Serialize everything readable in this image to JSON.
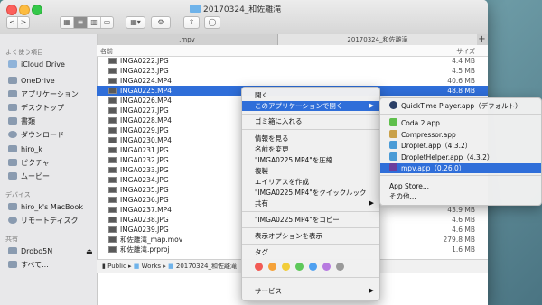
{
  "window": {
    "title": "20170324_和佐離滝",
    "tabs": [
      ".mpv",
      "20170324_和佐離滝"
    ],
    "add_tab": "+",
    "toolbar": {
      "back": "<",
      "forward": ">",
      "action": "⚙"
    }
  },
  "sidebar": {
    "favorites_header": "よく使う項目",
    "favorites": [
      "iCloud Drive",
      "OneDrive",
      "アプリケーション",
      "デスクトップ",
      "書類",
      "ダウンロード",
      "hiro_k",
      "ピクチャ",
      "ムービー"
    ],
    "devices_header": "デバイス",
    "devices": [
      "hiro_k's MacBook",
      "リモートディスク"
    ],
    "shared_header": "共有",
    "shared": [
      "Drobo5N",
      "すべて..."
    ]
  },
  "columns": {
    "name": "名前",
    "size": "サイズ"
  },
  "files": [
    {
      "name": "IMGA0222.JPG",
      "size": "4.4 MB"
    },
    {
      "name": "IMGA0223.JPG",
      "size": "4.5 MB"
    },
    {
      "name": "IMGA0224.MP4",
      "size": "40.6 MB"
    },
    {
      "name": "IMGA0225.MP4",
      "size": "48.8 MB",
      "selected": true
    },
    {
      "name": "IMGA0226.MP4",
      "size": ""
    },
    {
      "name": "IMGA0227.JPG",
      "size": ""
    },
    {
      "name": "IMGA0228.MP4",
      "size": ""
    },
    {
      "name": "IMGA0229.JPG",
      "size": ""
    },
    {
      "name": "IMGA0230.MP4",
      "size": ""
    },
    {
      "name": "IMGA0231.JPG",
      "size": ""
    },
    {
      "name": "IMGA0232.JPG",
      "size": ""
    },
    {
      "name": "IMGA0233.JPG",
      "size": ""
    },
    {
      "name": "IMGA0234.JPG",
      "size": ""
    },
    {
      "name": "IMGA0235.JPG",
      "size": ""
    },
    {
      "name": "IMGA0236.JPG",
      "size": ""
    },
    {
      "name": "IMGA0237.MP4",
      "size": "43.9 MB"
    },
    {
      "name": "IMGA0238.JPG",
      "size": "4.6 MB"
    },
    {
      "name": "IMGA0239.JPG",
      "size": "4.6 MB"
    },
    {
      "name": "和佐離滝_map.mov",
      "size": "279.8 MB"
    },
    {
      "name": "和佐離滝.prproj",
      "size": "1.6 MB"
    }
  ],
  "pathbar": [
    "Public",
    "Works",
    "20170324_和佐離滝"
  ],
  "context_menu": {
    "open": "開く",
    "open_with": "このアプリケーションで開く",
    "trash": "ゴミ箱に入れる",
    "get_info": "情報を見る",
    "rename": "名前を変更",
    "compress": "\"IMGA0225.MP4\"を圧縮",
    "duplicate": "複製",
    "make_alias": "エイリアスを作成",
    "quick_look": "\"IMGA0225.MP4\"をクイックルック",
    "share": "共有",
    "copy": "\"IMGA0225.MP4\"をコピー",
    "view_options": "表示オプションを表示",
    "tags": "タグ...",
    "services": "サービス",
    "tag_colors": [
      "#f25b55",
      "#f5a23a",
      "#f2cd3a",
      "#5ec85a",
      "#4fa0f0",
      "#b77ae0",
      "#9a9a9a"
    ]
  },
  "submenu": {
    "default_app": "QuickTime Player.app（デフォルト）",
    "apps": [
      {
        "name": "Coda 2.app",
        "color": "#5fbf4c"
      },
      {
        "name": "Compressor.app",
        "color": "#c9a14a"
      },
      {
        "name": "Droplet.app（4.3.2）",
        "color": "#4a9bd6"
      },
      {
        "name": "DropletHelper.app（4.3.2）",
        "color": "#4a9bd6"
      },
      {
        "name": "mpv.app（0.26.0）",
        "color": "#6b3f9e",
        "highlighted": true
      }
    ],
    "app_store": "App Store...",
    "other": "その他..."
  }
}
